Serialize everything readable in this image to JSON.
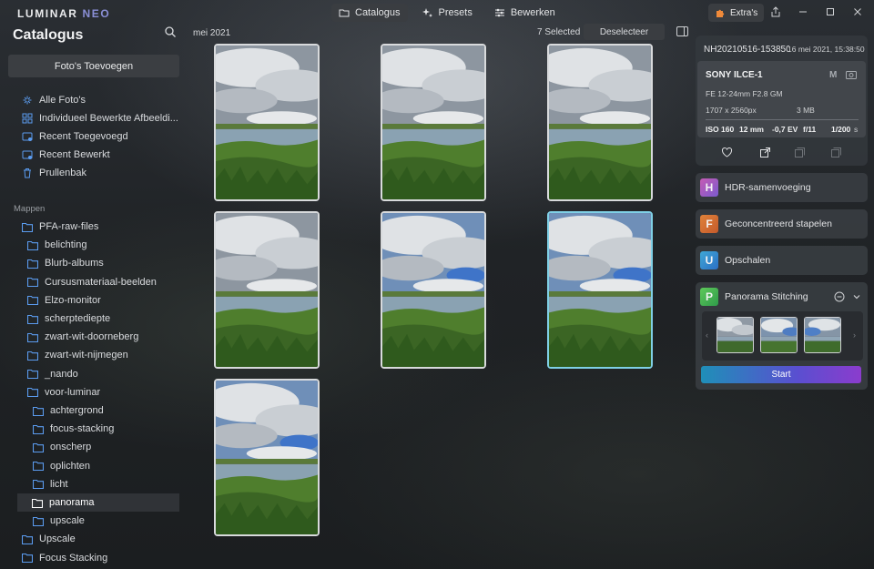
{
  "app": {
    "logo_main": "LUMINAR",
    "logo_sub": "NEO",
    "nav": [
      "Catalogus",
      "Presets",
      "Bewerken"
    ],
    "extras_label": "Extra's"
  },
  "sidebar": {
    "title": "Catalogus",
    "add_button": "Foto's Toevoegen",
    "items": [
      {
        "label": "Alle Foto's",
        "icon": "photos-icon"
      },
      {
        "label": "Individueel Bewerkte Afbeeldi...",
        "icon": "grid-icon"
      },
      {
        "label": "Recent Toegevoegd",
        "icon": "recent-added-icon"
      },
      {
        "label": "Recent Bewerkt",
        "icon": "recent-edited-icon"
      },
      {
        "label": "Prullenbak",
        "icon": "trash-icon"
      }
    ],
    "section_label": "Mappen",
    "folders": [
      {
        "label": "PFA-raw-files",
        "level": 0
      },
      {
        "label": "belichting",
        "level": 1
      },
      {
        "label": "Blurb-albums",
        "level": 1
      },
      {
        "label": "Cursusmateriaal-beelden",
        "level": 1
      },
      {
        "label": "Elzo-monitor",
        "level": 1
      },
      {
        "label": "scherptediepte",
        "level": 1
      },
      {
        "label": "zwart-wit-doorneberg",
        "level": 1
      },
      {
        "label": "zwart-wit-nijmegen",
        "level": 1
      },
      {
        "label": "_nando",
        "level": 1
      },
      {
        "label": "voor-luminar",
        "level": 1
      },
      {
        "label": "achtergrond",
        "level": 2
      },
      {
        "label": "focus-stacking",
        "level": 2
      },
      {
        "label": "onscherp",
        "level": 2
      },
      {
        "label": "oplichten",
        "level": 2
      },
      {
        "label": "licht",
        "level": 2
      },
      {
        "label": "panorama",
        "level": 2,
        "selected": true
      },
      {
        "label": "upscale",
        "level": 2
      },
      {
        "label": "Upscale",
        "level": 0
      },
      {
        "label": "Focus Stacking",
        "level": 0
      }
    ]
  },
  "grid": {
    "date_label": "mei 2021",
    "selected_count": "7 Selected",
    "deselect_label": "Deselecteer",
    "photos_count": 7
  },
  "info": {
    "filename": "NH20210516-153850",
    "date": "16 mei 2021, 15:38:50",
    "camera": "SONY ILCE-1",
    "mode": "M",
    "lens": "FE 12-24mm F2.8 GM",
    "dimensions": "1707 x 2560px",
    "filesize": "3 MB",
    "iso": "ISO 160",
    "focal": "12 mm",
    "ev": "-0,7 EV",
    "aperture": "f/11",
    "shutter": "1/200",
    "shutter_unit": "s"
  },
  "tools": [
    {
      "letter": "H",
      "label": "HDR-samenvoeging",
      "color": "#d65fb0"
    },
    {
      "letter": "F",
      "label": "Geconcentreerd stapelen",
      "color": "#e07b3a"
    },
    {
      "letter": "U",
      "label": "Opschalen",
      "color": "#3fa7d6"
    }
  ],
  "panorama": {
    "letter": "P",
    "label": "Panorama Stitching",
    "color": "#5ec95a",
    "start_label": "Start"
  }
}
